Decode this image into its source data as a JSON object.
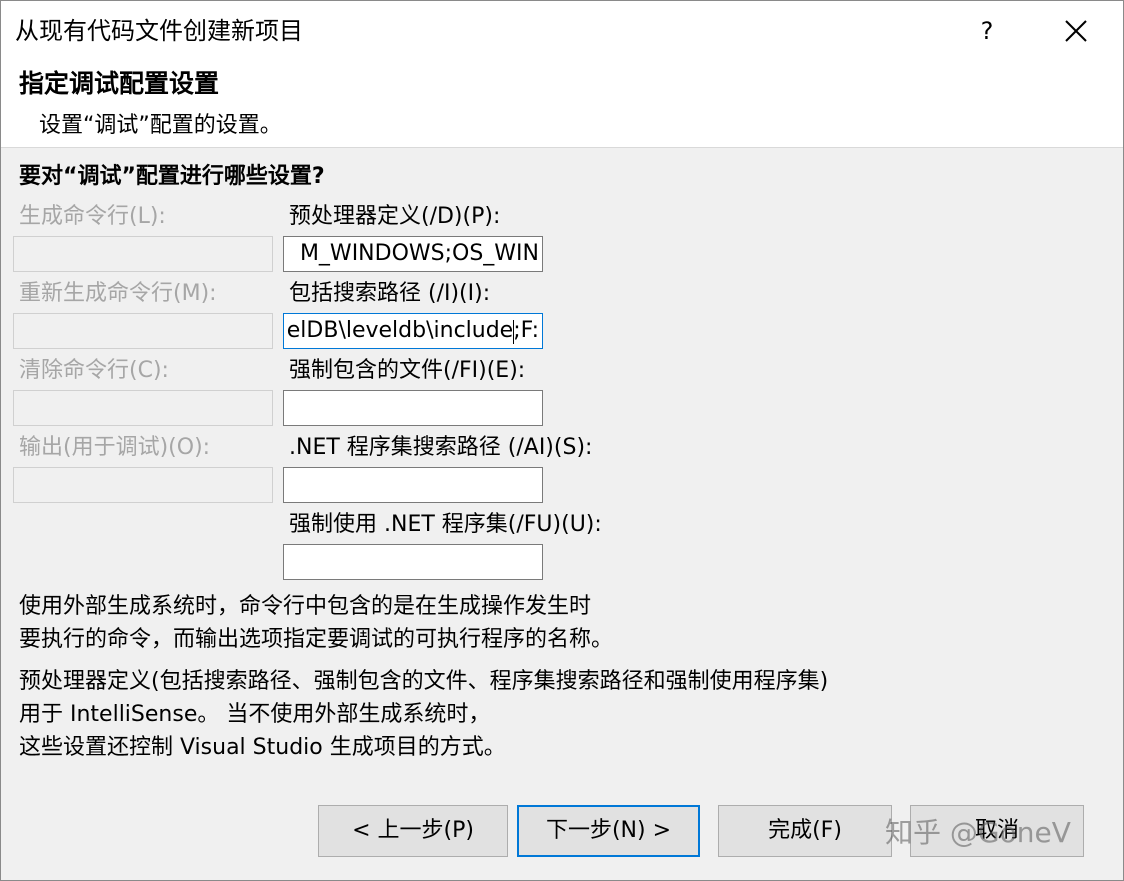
{
  "window": {
    "title": "从现有代码文件创建新项目",
    "help": "?"
  },
  "header": {
    "title": "指定调试配置设置",
    "subtitle": "设置“调试”配置的设置。"
  },
  "question": "要对“调试”配置进行哪些设置?",
  "left_fields": [
    {
      "label": "生成命令行(L):",
      "value": ""
    },
    {
      "label": "重新生成命令行(M):",
      "value": ""
    },
    {
      "label": "清除命令行(C):",
      "value": ""
    },
    {
      "label": "输出(用于调试)(O):",
      "value": ""
    }
  ],
  "right_fields": [
    {
      "label": "预处理器定义(/D)(P):",
      "value": "M_WINDOWS;OS_WIN"
    },
    {
      "label": "包括搜索路径 (/I)(I):",
      "value": "elDB\\leveldb\\include;F:"
    },
    {
      "label": "强制包含的文件(/FI)(E):",
      "value": ""
    },
    {
      "label": ".NET 程序集搜索路径 (/AI)(S):",
      "value": ""
    },
    {
      "label": "强制使用 .NET 程序集(/FU)(U):",
      "value": ""
    }
  ],
  "descriptions": [
    "使用外部生成系统时，命令行中包含的是在生成操作发生时",
    "要执行的命令，而输出选项指定要调试的可执行程序的名称。",
    "预处理器定义(包括搜索路径、强制包含的文件、程序集搜索路径和强制使用程序集)",
    "用于 IntelliSense。   当不使用外部生成系统时，",
    "这些设置还控制 Visual Studio 生成项目的方式。"
  ],
  "buttons": {
    "back": "< 上一步(P)",
    "next": "下一步(N) >",
    "finish": "完成(F)",
    "cancel": "取消"
  },
  "watermark": "知乎 @GoneV"
}
